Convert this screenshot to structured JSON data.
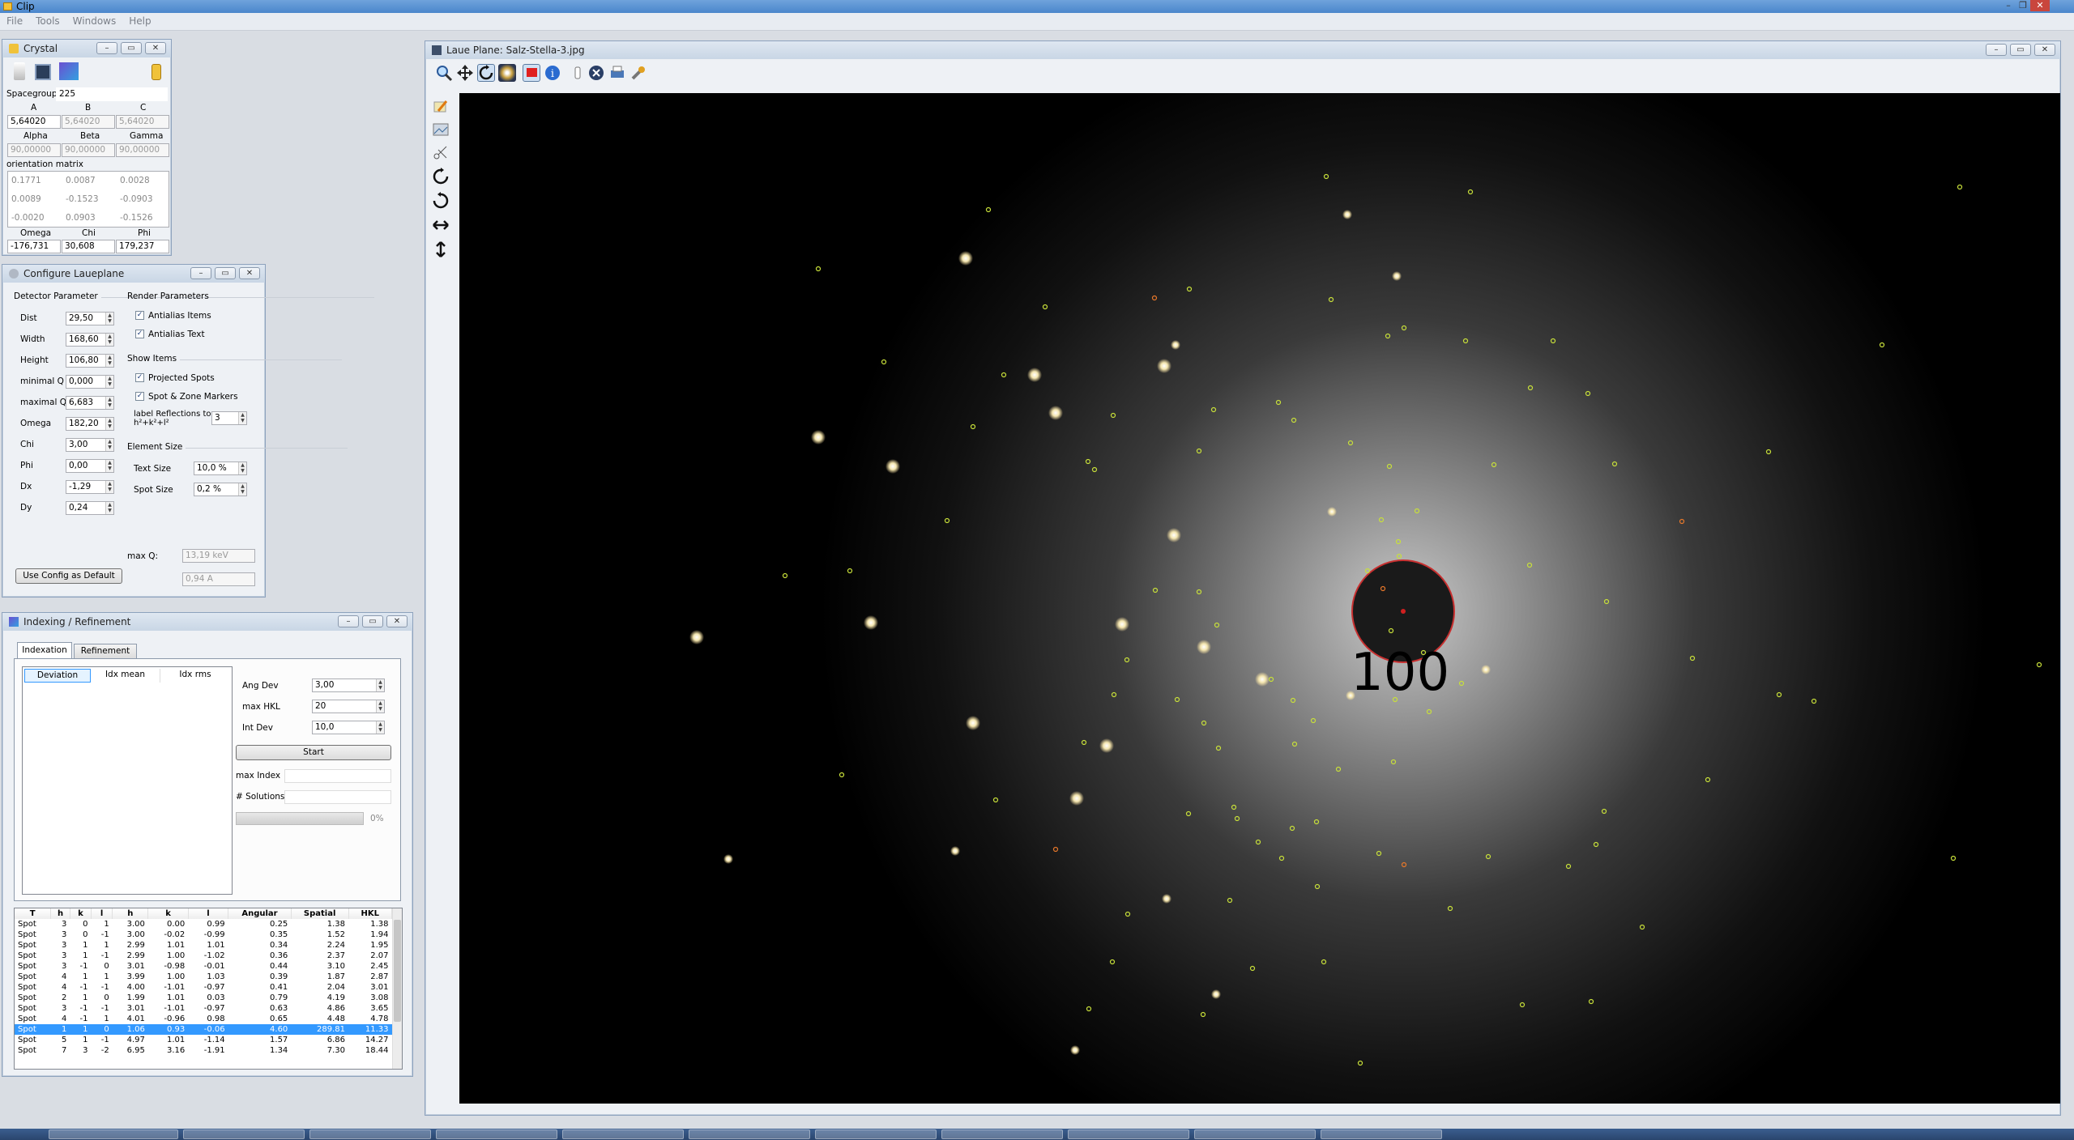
{
  "app": {
    "title": "Clip"
  },
  "menu": [
    "File",
    "Tools",
    "Windows",
    "Help"
  ],
  "crystal": {
    "title": "Crystal",
    "spacegroup_label": "Spacegroup",
    "spacegroup": "225",
    "abc_headers": [
      "A",
      "B",
      "C"
    ],
    "abc": [
      "5,64020",
      "5,64020",
      "5,64020"
    ],
    "angle_headers": [
      "Alpha",
      "Beta",
      "Gamma"
    ],
    "angles": [
      "90,00000",
      "90,00000",
      "90,00000"
    ],
    "orientation_label": "orientation matrix",
    "matrix": [
      [
        "0.1771",
        "0.0087",
        "0.0028"
      ],
      [
        "0.0089",
        "-0.1523",
        "-0.0903"
      ],
      [
        "-0.0020",
        "0.0903",
        "-0.1526"
      ]
    ],
    "euler_headers": [
      "Omega",
      "Chi",
      "Phi"
    ],
    "euler": [
      "-176,731",
      "30,608",
      "179,237"
    ]
  },
  "config": {
    "title": "Configure Laueplane",
    "detector_label": "Detector Parameter",
    "params": [
      {
        "label": "Dist",
        "value": "29,50"
      },
      {
        "label": "Width",
        "value": "168,60"
      },
      {
        "label": "Height",
        "value": "106,80"
      },
      {
        "label": "minimal Q",
        "value": "0,000"
      },
      {
        "label": "maximal Q",
        "value": "6,683"
      },
      {
        "label": "Omega",
        "value": "182,20"
      },
      {
        "label": "Chi",
        "value": "3,00"
      },
      {
        "label": "Phi",
        "value": "0,00"
      },
      {
        "label": "Dx",
        "value": "-1,29"
      },
      {
        "label": "Dy",
        "value": "0,24"
      }
    ],
    "render_label": "Render Parameters",
    "antialias_items": "Antialias Items",
    "antialias_text": "Antialias Text",
    "show_label": "Show Items",
    "projected_spots": "Projected Spots",
    "spot_zone": "Spot & Zone Markers",
    "label_refl": "label Reflections to",
    "label_refl_2": "h²+k²+l²",
    "label_refl_value": "3",
    "element_label": "Element Size",
    "text_size_label": "Text Size",
    "text_size": "10,0 %",
    "spot_size_label": "Spot Size",
    "spot_size": "0,2 %",
    "maxq_label": "max Q:",
    "maxq_kev": "13,19 keV",
    "maxq_a": "0,94 A",
    "default_btn": "Use Config as Default"
  },
  "indexing": {
    "title": "Indexing / Refinement",
    "tabs": [
      "Indexation",
      "Refinement"
    ],
    "list_headers": [
      "Deviation",
      "Idx mean",
      "Idx rms"
    ],
    "ang_dev_label": "Ang Dev",
    "ang_dev": "3,00",
    "max_hkl_label": "max HKL",
    "max_hkl": "20",
    "int_dev_label": "Int Dev",
    "int_dev": "10,0",
    "start_btn": "Start",
    "max_index_label": "max Index",
    "solutions_label": "# Solutions",
    "progress": 0,
    "progress_text": "0%",
    "table_headers": [
      "T",
      "h",
      "k",
      "l",
      "h",
      "k",
      "l",
      "Angular",
      "Spatial",
      "HKL"
    ],
    "rows": [
      [
        "Spot",
        "3",
        "0",
        "1",
        "3.00",
        "0.00",
        "0.99",
        "0.25",
        "1.38",
        "1.38"
      ],
      [
        "Spot",
        "3",
        "0",
        "-1",
        "3.00",
        "-0.02",
        "-0.99",
        "0.35",
        "1.52",
        "1.94"
      ],
      [
        "Spot",
        "3",
        "1",
        "1",
        "2.99",
        "1.01",
        "1.01",
        "0.34",
        "2.24",
        "1.95"
      ],
      [
        "Spot",
        "3",
        "1",
        "-1",
        "2.99",
        "1.00",
        "-1.02",
        "0.36",
        "2.37",
        "2.07"
      ],
      [
        "Spot",
        "3",
        "-1",
        "0",
        "3.01",
        "-0.98",
        "-0.01",
        "0.44",
        "3.10",
        "2.45"
      ],
      [
        "Spot",
        "4",
        "1",
        "1",
        "3.99",
        "1.00",
        "1.03",
        "0.39",
        "1.87",
        "2.87"
      ],
      [
        "Spot",
        "4",
        "-1",
        "-1",
        "4.00",
        "-1.01",
        "-0.97",
        "0.41",
        "2.04",
        "3.01"
      ],
      [
        "Spot",
        "2",
        "1",
        "0",
        "1.99",
        "1.01",
        "0.03",
        "0.79",
        "4.19",
        "3.08"
      ],
      [
        "Spot",
        "3",
        "-1",
        "-1",
        "3.01",
        "-1.01",
        "-0.97",
        "0.63",
        "4.86",
        "3.65"
      ],
      [
        "Spot",
        "4",
        "-1",
        "1",
        "4.01",
        "-0.96",
        "0.98",
        "0.65",
        "4.48",
        "4.78"
      ],
      [
        "Spot",
        "1",
        "1",
        "0",
        "1.06",
        "0.93",
        "-0.06",
        "4.60",
        "289.81",
        "11.33"
      ],
      [
        "Spot",
        "5",
        "1",
        "-1",
        "4.97",
        "1.01",
        "-1.14",
        "1.57",
        "6.86",
        "14.27"
      ],
      [
        "Spot",
        "7",
        "3",
        "-2",
        "6.95",
        "3.16",
        "-1.91",
        "1.34",
        "7.30",
        "18.44"
      ]
    ],
    "selected_row": 10
  },
  "laue": {
    "title": "Laue Plane: Salz-Stella-3.jpg",
    "label": "100",
    "colors": {
      "marker": "#c8e03a",
      "marker_orange": "#e8782a",
      "circle": "#c83030"
    }
  },
  "icons": {
    "zoom": "magnifier-icon",
    "pan": "move-icon",
    "rotate": "rotate-icon",
    "star": "starburst-icon",
    "flag": "red-flag-icon",
    "info": "info-icon",
    "stop": "stop-icon",
    "print": "printer-icon",
    "wrench": "wrench-icon"
  }
}
